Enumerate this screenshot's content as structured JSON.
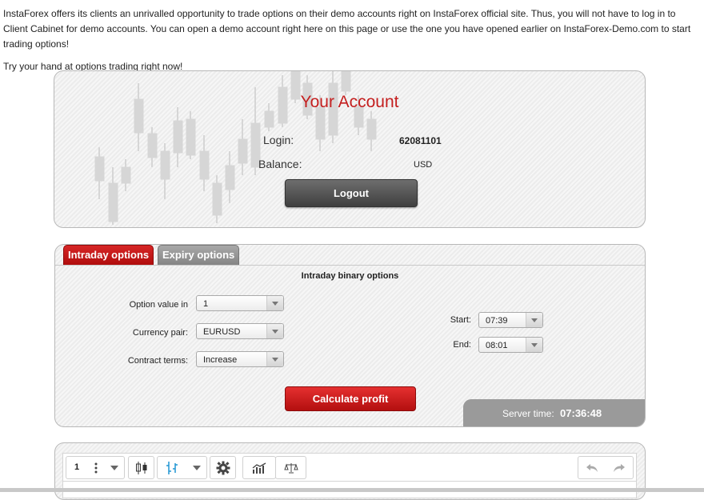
{
  "intro": {
    "paragraph": "InstaForex offers its clients an unrivalled opportunity to trade options on their demo accounts right on InstaForex official site. Thus, you will not have to log in to Client Cabinet for demo accounts. You can open a demo account right here on this page or use the one you have opened earlier on InstaForex-Demo.com to start trading options!",
    "call_to_action": "Try your hand at options trading right now!"
  },
  "account": {
    "title": "Your Account",
    "login_label": "Login:",
    "login_value": "62081101",
    "balance_label": "Balance:",
    "balance_value": "USD",
    "logout_label": "Logout"
  },
  "options": {
    "tabs": [
      {
        "label": "Intraday options",
        "active": true
      },
      {
        "label": "Expiry options",
        "active": false
      }
    ],
    "heading": "Intraday binary options",
    "option_value_label": "Option value in",
    "option_value": "1",
    "currency_pair_label": "Currency pair:",
    "currency_pair": "EURUSD",
    "contract_terms_label": "Contract terms:",
    "contract_terms": "Increase",
    "start_label": "Start:",
    "start_value": "07:39",
    "end_label": "End:",
    "end_value": "08:01",
    "calculate_label": "Calculate profit",
    "server_time_label": "Server time:",
    "server_time": "07:36:48"
  },
  "chart_toolbar": {
    "interval": "1",
    "icons": [
      "more-vertical-icon",
      "chevron-down-icon",
      "candlestick-icon",
      "bar-chart-icon",
      "chevron-down-icon",
      "gear-icon",
      "indicators-icon",
      "compare-icon",
      "undo-icon",
      "redo-icon"
    ]
  },
  "colors": {
    "accent_red": "#c41f1f",
    "logout_dark": "#4a4a4a",
    "server_bar": "#9a9a9a",
    "toolbar_blue": "#2196d3"
  }
}
